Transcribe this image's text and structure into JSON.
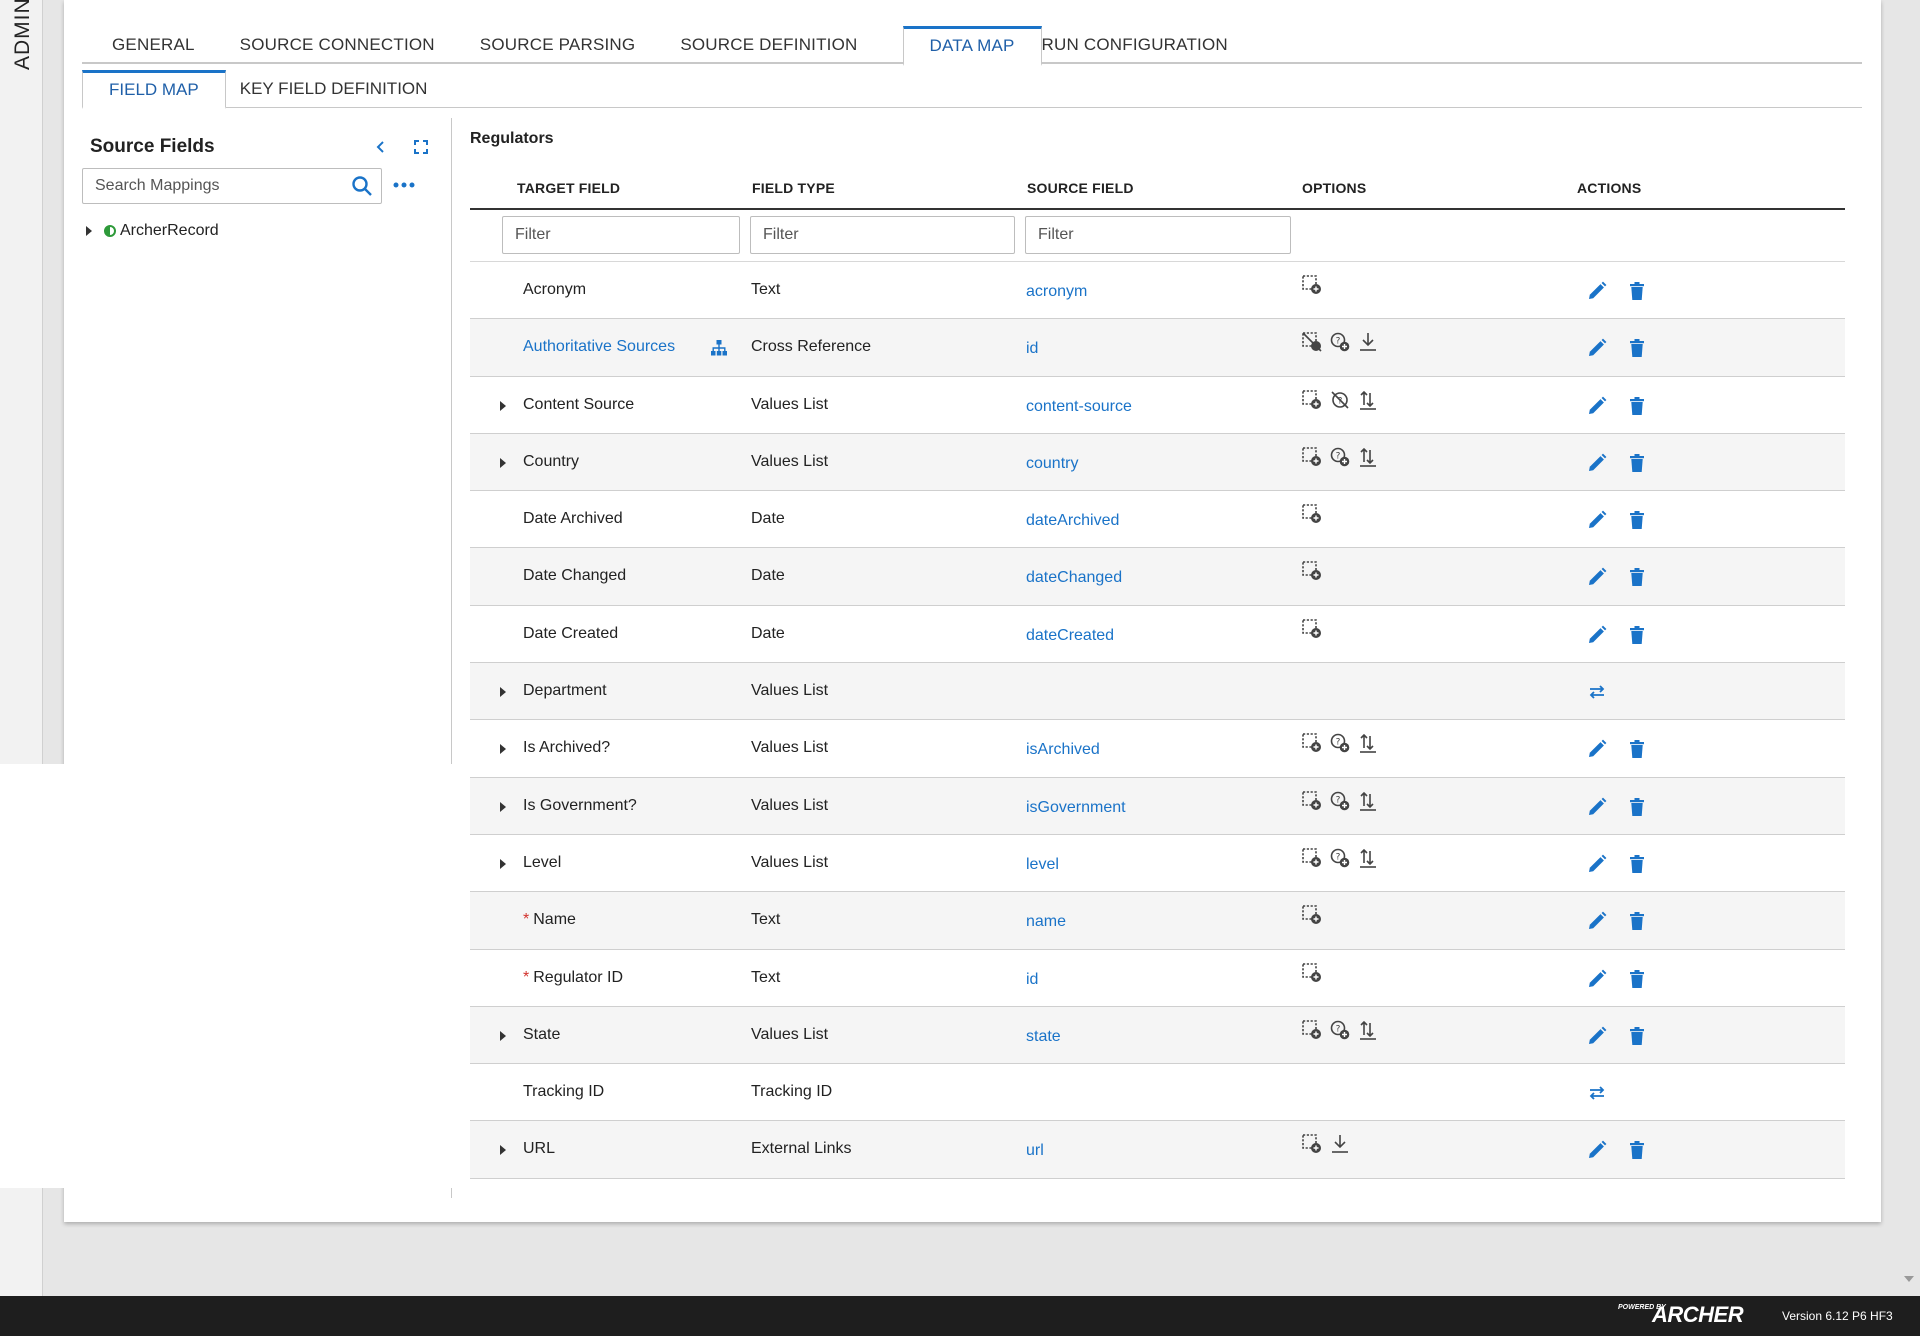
{
  "side": {
    "label": "ADMINI"
  },
  "tabs": [
    "GENERAL",
    "SOURCE CONNECTION",
    "SOURCE PARSING",
    "SOURCE DEFINITION",
    "DATA MAP",
    "RUN CONFIGURATION"
  ],
  "active_tab": "DATA MAP",
  "subtabs": [
    "FIELD MAP",
    "KEY FIELD DEFINITION"
  ],
  "active_subtab": "FIELD MAP",
  "left": {
    "title": "Source Fields",
    "search_placeholder": "Search Mappings",
    "tree_root": "ArcherRecord"
  },
  "grid": {
    "title": "Regulators",
    "columns": {
      "target": "TARGET FIELD",
      "type": "FIELD TYPE",
      "source": "SOURCE FIELD",
      "options": "OPTIONS",
      "actions": "ACTIONS"
    },
    "filter_placeholder": "Filter",
    "rows": [
      {
        "target": "Acronym",
        "type": "Text",
        "source": "acronym",
        "expandable": false,
        "required": false,
        "link": false,
        "options": [
          "default-value"
        ],
        "actions": [
          "edit",
          "delete"
        ]
      },
      {
        "target": "Authoritative Sources",
        "type": "Cross Reference",
        "source": "id",
        "expandable": false,
        "required": false,
        "link": true,
        "options": [
          "default-value-disabled",
          "lookup",
          "download"
        ],
        "actions": [
          "edit",
          "delete"
        ]
      },
      {
        "target": "Content Source",
        "type": "Values List",
        "source": "content-source",
        "expandable": true,
        "required": false,
        "link": false,
        "options": [
          "default-value",
          "lookup-disabled",
          "sort"
        ],
        "actions": [
          "edit",
          "delete"
        ]
      },
      {
        "target": "Country",
        "type": "Values List",
        "source": "country",
        "expandable": true,
        "required": false,
        "link": false,
        "options": [
          "default-value",
          "lookup",
          "sort"
        ],
        "actions": [
          "edit",
          "delete"
        ]
      },
      {
        "target": "Date Archived",
        "type": "Date",
        "source": "dateArchived",
        "expandable": false,
        "required": false,
        "link": false,
        "options": [
          "default-value"
        ],
        "actions": [
          "edit",
          "delete"
        ]
      },
      {
        "target": "Date Changed",
        "type": "Date",
        "source": "dateChanged",
        "expandable": false,
        "required": false,
        "link": false,
        "options": [
          "default-value"
        ],
        "actions": [
          "edit",
          "delete"
        ]
      },
      {
        "target": "Date Created",
        "type": "Date",
        "source": "dateCreated",
        "expandable": false,
        "required": false,
        "link": false,
        "options": [
          "default-value"
        ],
        "actions": [
          "edit",
          "delete"
        ]
      },
      {
        "target": "Department",
        "type": "Values List",
        "source": "",
        "expandable": true,
        "required": false,
        "link": false,
        "options": [],
        "actions": [
          "map"
        ]
      },
      {
        "target": "Is Archived?",
        "type": "Values List",
        "source": "isArchived",
        "expandable": true,
        "required": false,
        "link": false,
        "options": [
          "default-value",
          "lookup",
          "sort"
        ],
        "actions": [
          "edit",
          "delete"
        ]
      },
      {
        "target": "Is Government?",
        "type": "Values List",
        "source": "isGovernment",
        "expandable": true,
        "required": false,
        "link": false,
        "options": [
          "default-value",
          "lookup",
          "sort"
        ],
        "actions": [
          "edit",
          "delete"
        ]
      },
      {
        "target": "Level",
        "type": "Values List",
        "source": "level",
        "expandable": true,
        "required": false,
        "link": false,
        "options": [
          "default-value",
          "lookup",
          "sort"
        ],
        "actions": [
          "edit",
          "delete"
        ]
      },
      {
        "target": "Name",
        "type": "Text",
        "source": "name",
        "expandable": false,
        "required": true,
        "link": false,
        "options": [
          "default-value"
        ],
        "actions": [
          "edit",
          "delete"
        ]
      },
      {
        "target": "Regulator ID",
        "type": "Text",
        "source": "id",
        "expandable": false,
        "required": true,
        "link": false,
        "options": [
          "default-value"
        ],
        "actions": [
          "edit",
          "delete"
        ]
      },
      {
        "target": "State",
        "type": "Values List",
        "source": "state",
        "expandable": true,
        "required": false,
        "link": false,
        "options": [
          "default-value",
          "lookup",
          "sort"
        ],
        "actions": [
          "edit",
          "delete"
        ]
      },
      {
        "target": "Tracking ID",
        "type": "Tracking ID",
        "source": "",
        "expandable": false,
        "required": false,
        "link": false,
        "options": [],
        "actions": [
          "map"
        ]
      },
      {
        "target": "URL",
        "type": "External Links",
        "source": "url",
        "expandable": true,
        "required": false,
        "link": false,
        "options": [
          "default-value",
          "download"
        ],
        "actions": [
          "edit",
          "delete"
        ]
      }
    ]
  },
  "footer": {
    "powered": "POWERED BY",
    "brand": "ARCHER",
    "version": "Version 6.12 P6 HF3"
  },
  "colors": {
    "accent": "#1a73c8",
    "required": "#d2322d",
    "footer_bg": "#1e1e1e"
  }
}
